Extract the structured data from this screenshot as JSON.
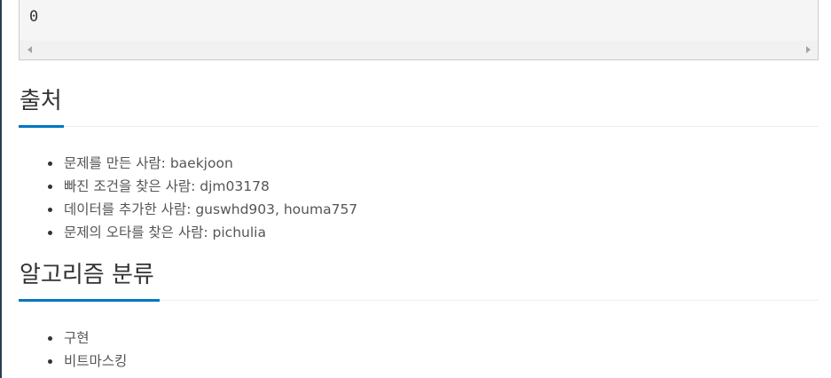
{
  "output": {
    "value": "0"
  },
  "sections": {
    "source": {
      "title": "출처",
      "items": [
        "문제를 만든 사람: baekjoon",
        "빠진 조건을 찾은 사람: djm03178",
        "데이터를 추가한 사람: guswhd903, houma757",
        "문제의 오타를 찾은 사람: pichulia"
      ]
    },
    "algorithm": {
      "title": "알고리즘 분류",
      "items": [
        "구현",
        "비트마스킹"
      ]
    }
  },
  "colors": {
    "accent": "#0076c0",
    "text": "#555555",
    "heading": "#333333",
    "code_bg": "#f5f5f5"
  }
}
